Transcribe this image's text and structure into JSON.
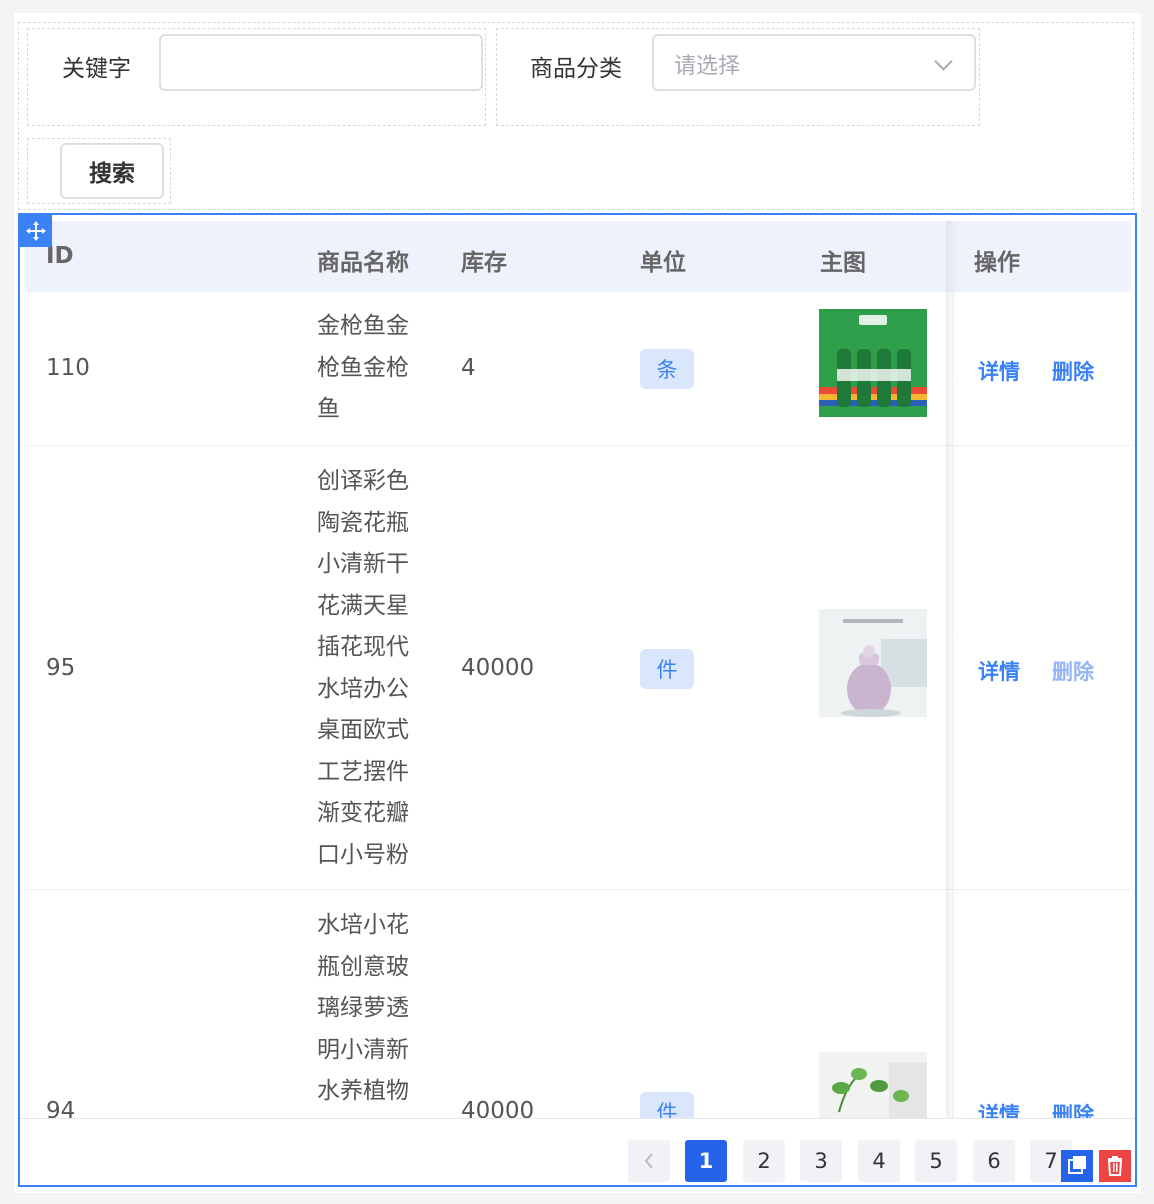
{
  "search_form": {
    "keyword_label": "关键字",
    "keyword_value": "",
    "category_label": "商品分类",
    "category_placeholder": "请选择",
    "search_button": "搜索"
  },
  "table": {
    "columns": [
      "ID",
      "商品名称",
      "库存",
      "单位",
      "主图",
      "操作"
    ],
    "rows": [
      {
        "id": "110",
        "name": "金枪鱼金枪鱼金枪鱼",
        "stock": "4",
        "unit": "条",
        "actions": {
          "detail": "详情",
          "delete": "删除"
        }
      },
      {
        "id": "95",
        "name": "创译彩色陶瓷花瓶小清新干花满天星插花现代水培办公桌面欧式工艺摆件渐变花瓣口小号粉",
        "stock": "40000",
        "unit": "件",
        "actions": {
          "detail": "详情",
          "delete": "删除"
        }
      },
      {
        "id": "94",
        "name": "水培小花瓶创意玻璃绿萝透明小清新水养植物",
        "stock": "40000",
        "unit": "件",
        "actions": {
          "detail": "详情",
          "delete": "删除"
        }
      }
    ]
  },
  "pagination": {
    "pages": [
      "1",
      "2",
      "3",
      "4",
      "5",
      "6",
      "7"
    ],
    "current": "1"
  },
  "colors": {
    "accent": "#3b82f6",
    "header_bg": "#eef2fd",
    "danger": "#ef4444"
  },
  "icons": {
    "drag": "move-icon",
    "select": "chevron-down-icon",
    "prev": "chevron-left-icon",
    "copy": "copy-icon",
    "delete": "trash-icon"
  }
}
